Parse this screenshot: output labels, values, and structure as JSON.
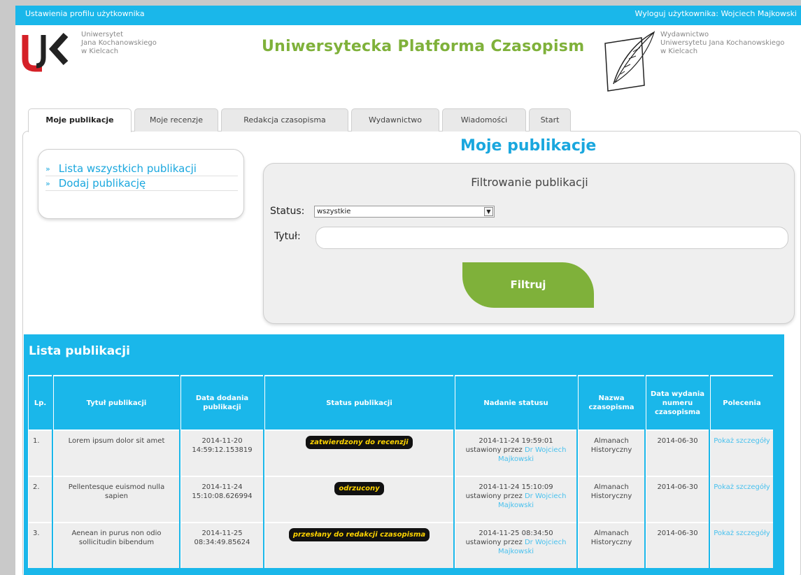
{
  "topbar": {
    "profile_settings": "Ustawienia profilu użytkownika",
    "logout": "Wyloguj użytkownika: Wojciech Majkowski"
  },
  "header": {
    "university": [
      "Uniwersytet",
      "Jana Kochanowskiego",
      "w Kielcach"
    ],
    "platform_title": "Uniwersytecka Platforma Czasopism",
    "publisher": [
      "Wydawnictwo",
      "Uniwersytetu Jana Kochanowskiego",
      "w Kielcach"
    ]
  },
  "tabs": [
    {
      "label": "Moje publikacje",
      "active": true
    },
    {
      "label": "Moje recenzje",
      "active": false
    },
    {
      "label": "Redakcja czasopisma",
      "active": false
    },
    {
      "label": "Wydawnictwo",
      "active": false
    },
    {
      "label": "Wiadomości",
      "active": false
    },
    {
      "label": "Start",
      "active": false
    }
  ],
  "page_heading": "Moje publikacje",
  "menu": {
    "items": [
      {
        "bullet": "»",
        "label": "Lista wszystkich publikacji"
      },
      {
        "bullet": "»",
        "label": "Dodaj publikację"
      }
    ]
  },
  "filter": {
    "title": "Filtrowanie publikacji",
    "status_label": "Status:",
    "status_value": "wszystkie",
    "title_label": "Tytuł:",
    "title_value": "",
    "button_label": "Filtruj"
  },
  "list": {
    "title": "Lista publikacji",
    "columns": [
      "Lp.",
      "Tytuł publikacji",
      "Data dodania publikacji",
      "Status publikacji",
      "Nadanie statusu",
      "Nazwa czasopisma",
      "Data wydania numeru czasopisma",
      "Polecenia"
    ],
    "rows": [
      {
        "lp": "1.",
        "title": "Lorem ipsum dolor sit amet",
        "date_added": "2014-11-20 14:59:12.153819",
        "status": "zatwierdzony do recenzji",
        "status_date": "2014-11-24 19:59:01",
        "set_by_prefix": "ustawiony przez",
        "set_by": "Dr Wojciech Majkowski",
        "journal": "Almanach Historyczny",
        "issue_date": "2014-06-30",
        "action": "Pokaż szczegóły"
      },
      {
        "lp": "2.",
        "title": "Pellentesque euismod nulla sapien",
        "date_added": "2014-11-24 15:10:08.626994",
        "status": "odrzucony",
        "status_date": "2014-11-24 15:10:09",
        "set_by_prefix": "ustawiony przez",
        "set_by": "Dr Wojciech Majkowski",
        "journal": "Almanach Historyczny",
        "issue_date": "2014-06-30",
        "action": "Pokaż szczegóły"
      },
      {
        "lp": "3.",
        "title": "Aenean in purus non odio sollicitudin bibendum",
        "date_added": "2014-11-25 08:34:49.85624",
        "status": "przesłany do redakcji czasopisma",
        "status_date": "2014-11-25 08:34:50",
        "set_by_prefix": "ustawiony przez",
        "set_by": "Dr Wojciech Majkowski",
        "journal": "Almanach Historyczny",
        "issue_date": "2014-06-30",
        "action": "Pokaż szczegóły"
      }
    ]
  },
  "colors": {
    "accent_blue": "#1ab7ea",
    "brand_green": "#7fb13a",
    "badge_bg": "#111111",
    "badge_text": "#ffd400"
  }
}
